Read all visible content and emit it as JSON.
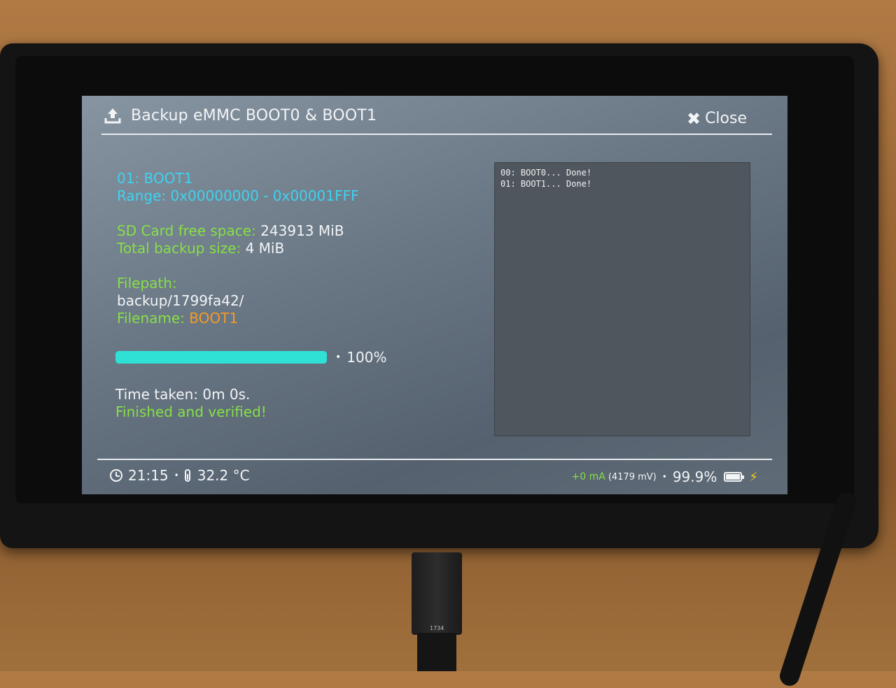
{
  "header": {
    "title": "Backup eMMC BOOT0 & BOOT1",
    "close_label": "Close"
  },
  "info": {
    "partition": "01: BOOT1",
    "range": "Range: 0x00000000 - 0x00001FFF",
    "sd_free_label": "SD Card free space:",
    "sd_free_value": "243913 MiB",
    "total_size_label": "Total backup size:",
    "total_size_value": "4 MiB",
    "filepath_label": "Filepath:",
    "filepath_value": "backup/1799fa42/",
    "filename_label": "Filename:",
    "filename_value": "BOOT1"
  },
  "progress": {
    "percent_label": "100%",
    "fraction": 1.0
  },
  "result": {
    "time_taken": "Time taken: 0m 0s.",
    "status": "Finished and verified!"
  },
  "log": {
    "lines": [
      "00: BOOT0... Done!",
      "01: BOOT1... Done!"
    ]
  },
  "footer": {
    "time": "21:15",
    "temperature": "32.2 °C",
    "current": "+0 mA",
    "voltage": "(4179 mV)",
    "battery_percent": "99.9%",
    "battery_level": 0.999
  },
  "cable": {
    "label": "1734"
  },
  "colors": {
    "cyan": "#3fd2ef",
    "green": "#86e046",
    "orange": "#f29b2a",
    "progress": "#2fe0d4"
  }
}
